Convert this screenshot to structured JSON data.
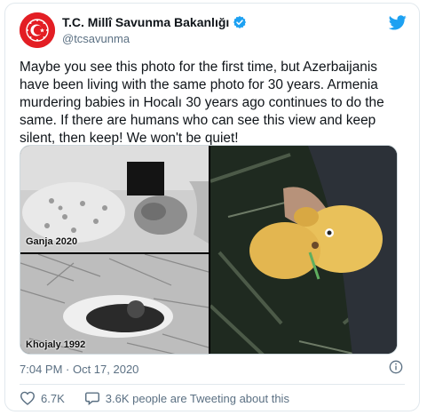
{
  "account": {
    "display_name": "T.C. Millî Savunma Bakanlığı",
    "handle": "@tcsavunma",
    "verified": true
  },
  "tweet": {
    "text": "Maybe you see this photo for the first time, but Azerbaijanis have been living with the same photo for 30 years. Armenia murdering babies in Hocalı 30 years ago continues to do the same. If there are humans who can see this view and keep silent, then keep! We won't be quiet!",
    "timestamp": "7:04 PM · Oct 17, 2020"
  },
  "media": {
    "photo_top_left_caption": "Ganja 2020",
    "photo_bottom_left_caption": "Khojaly 1992"
  },
  "actions": {
    "likes": "6.7K",
    "retweets_text": "3.6K people are Tweeting about this"
  },
  "colors": {
    "twitter_blue": "#1da1f2",
    "like_pink": "#e0245e",
    "muted": "#5b7083",
    "emblem_red": "#e31e24"
  },
  "icons": [
    "emblem-icon",
    "verified-badge-icon",
    "twitter-bird-icon",
    "info-icon",
    "heart-icon",
    "comment-icon"
  ]
}
